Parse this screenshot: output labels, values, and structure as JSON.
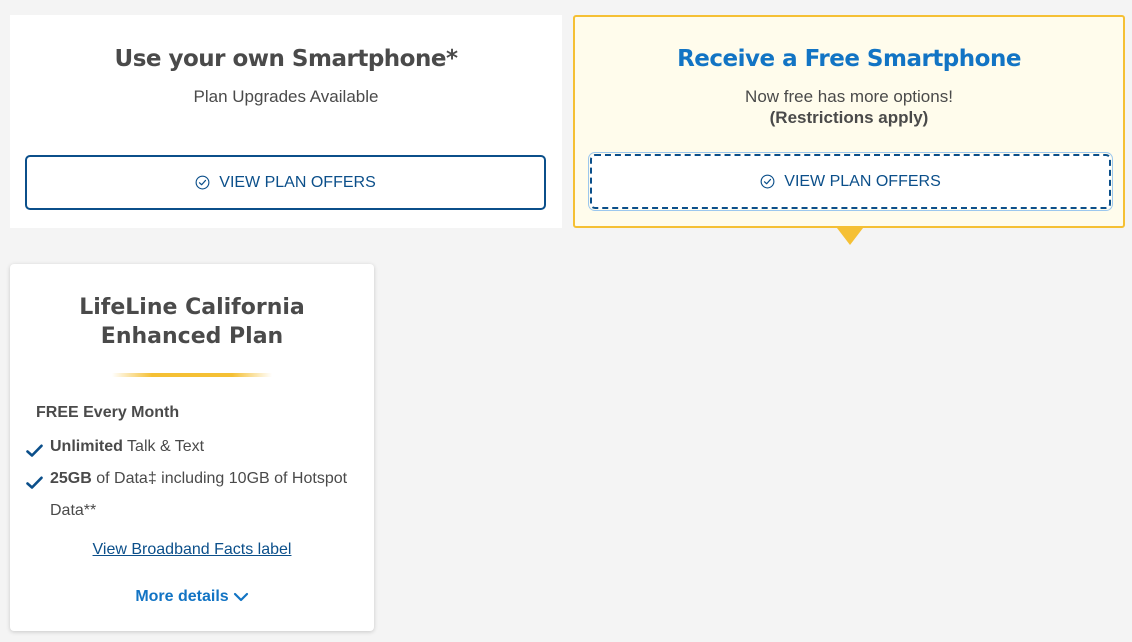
{
  "byo": {
    "title": "Use your own Smartphone*",
    "subtitle": "Plan Upgrades Available",
    "button_label": "VIEW PLAN OFFERS"
  },
  "free": {
    "title": "Receive a Free Smartphone",
    "subtitle": "Now free has more options!",
    "note": "(Restrictions apply)",
    "button_label": "VIEW PLAN OFFERS"
  },
  "plan": {
    "title_line1": "LifeLine California",
    "title_line2": "Enhanced Plan",
    "free_label": "FREE Every Month",
    "features": [
      {
        "bold": "Unlimited",
        "text": " Talk & Text"
      },
      {
        "bold": "25GB",
        "text": " of Data‡ including 10GB of Hotspot Data**"
      }
    ],
    "facts_link": "View Broadband Facts label",
    "more_details": "More details"
  },
  "colors": {
    "brand_blue": "#1274c4",
    "dark_blue": "#0b4f8a",
    "accent_yellow": "#f5c034",
    "highlight_bg": "#fffcec"
  },
  "icons": {
    "button_icon": "check-circle-icon",
    "feature_icon": "checkmark-icon",
    "expand_icon": "chevron-down-icon"
  }
}
